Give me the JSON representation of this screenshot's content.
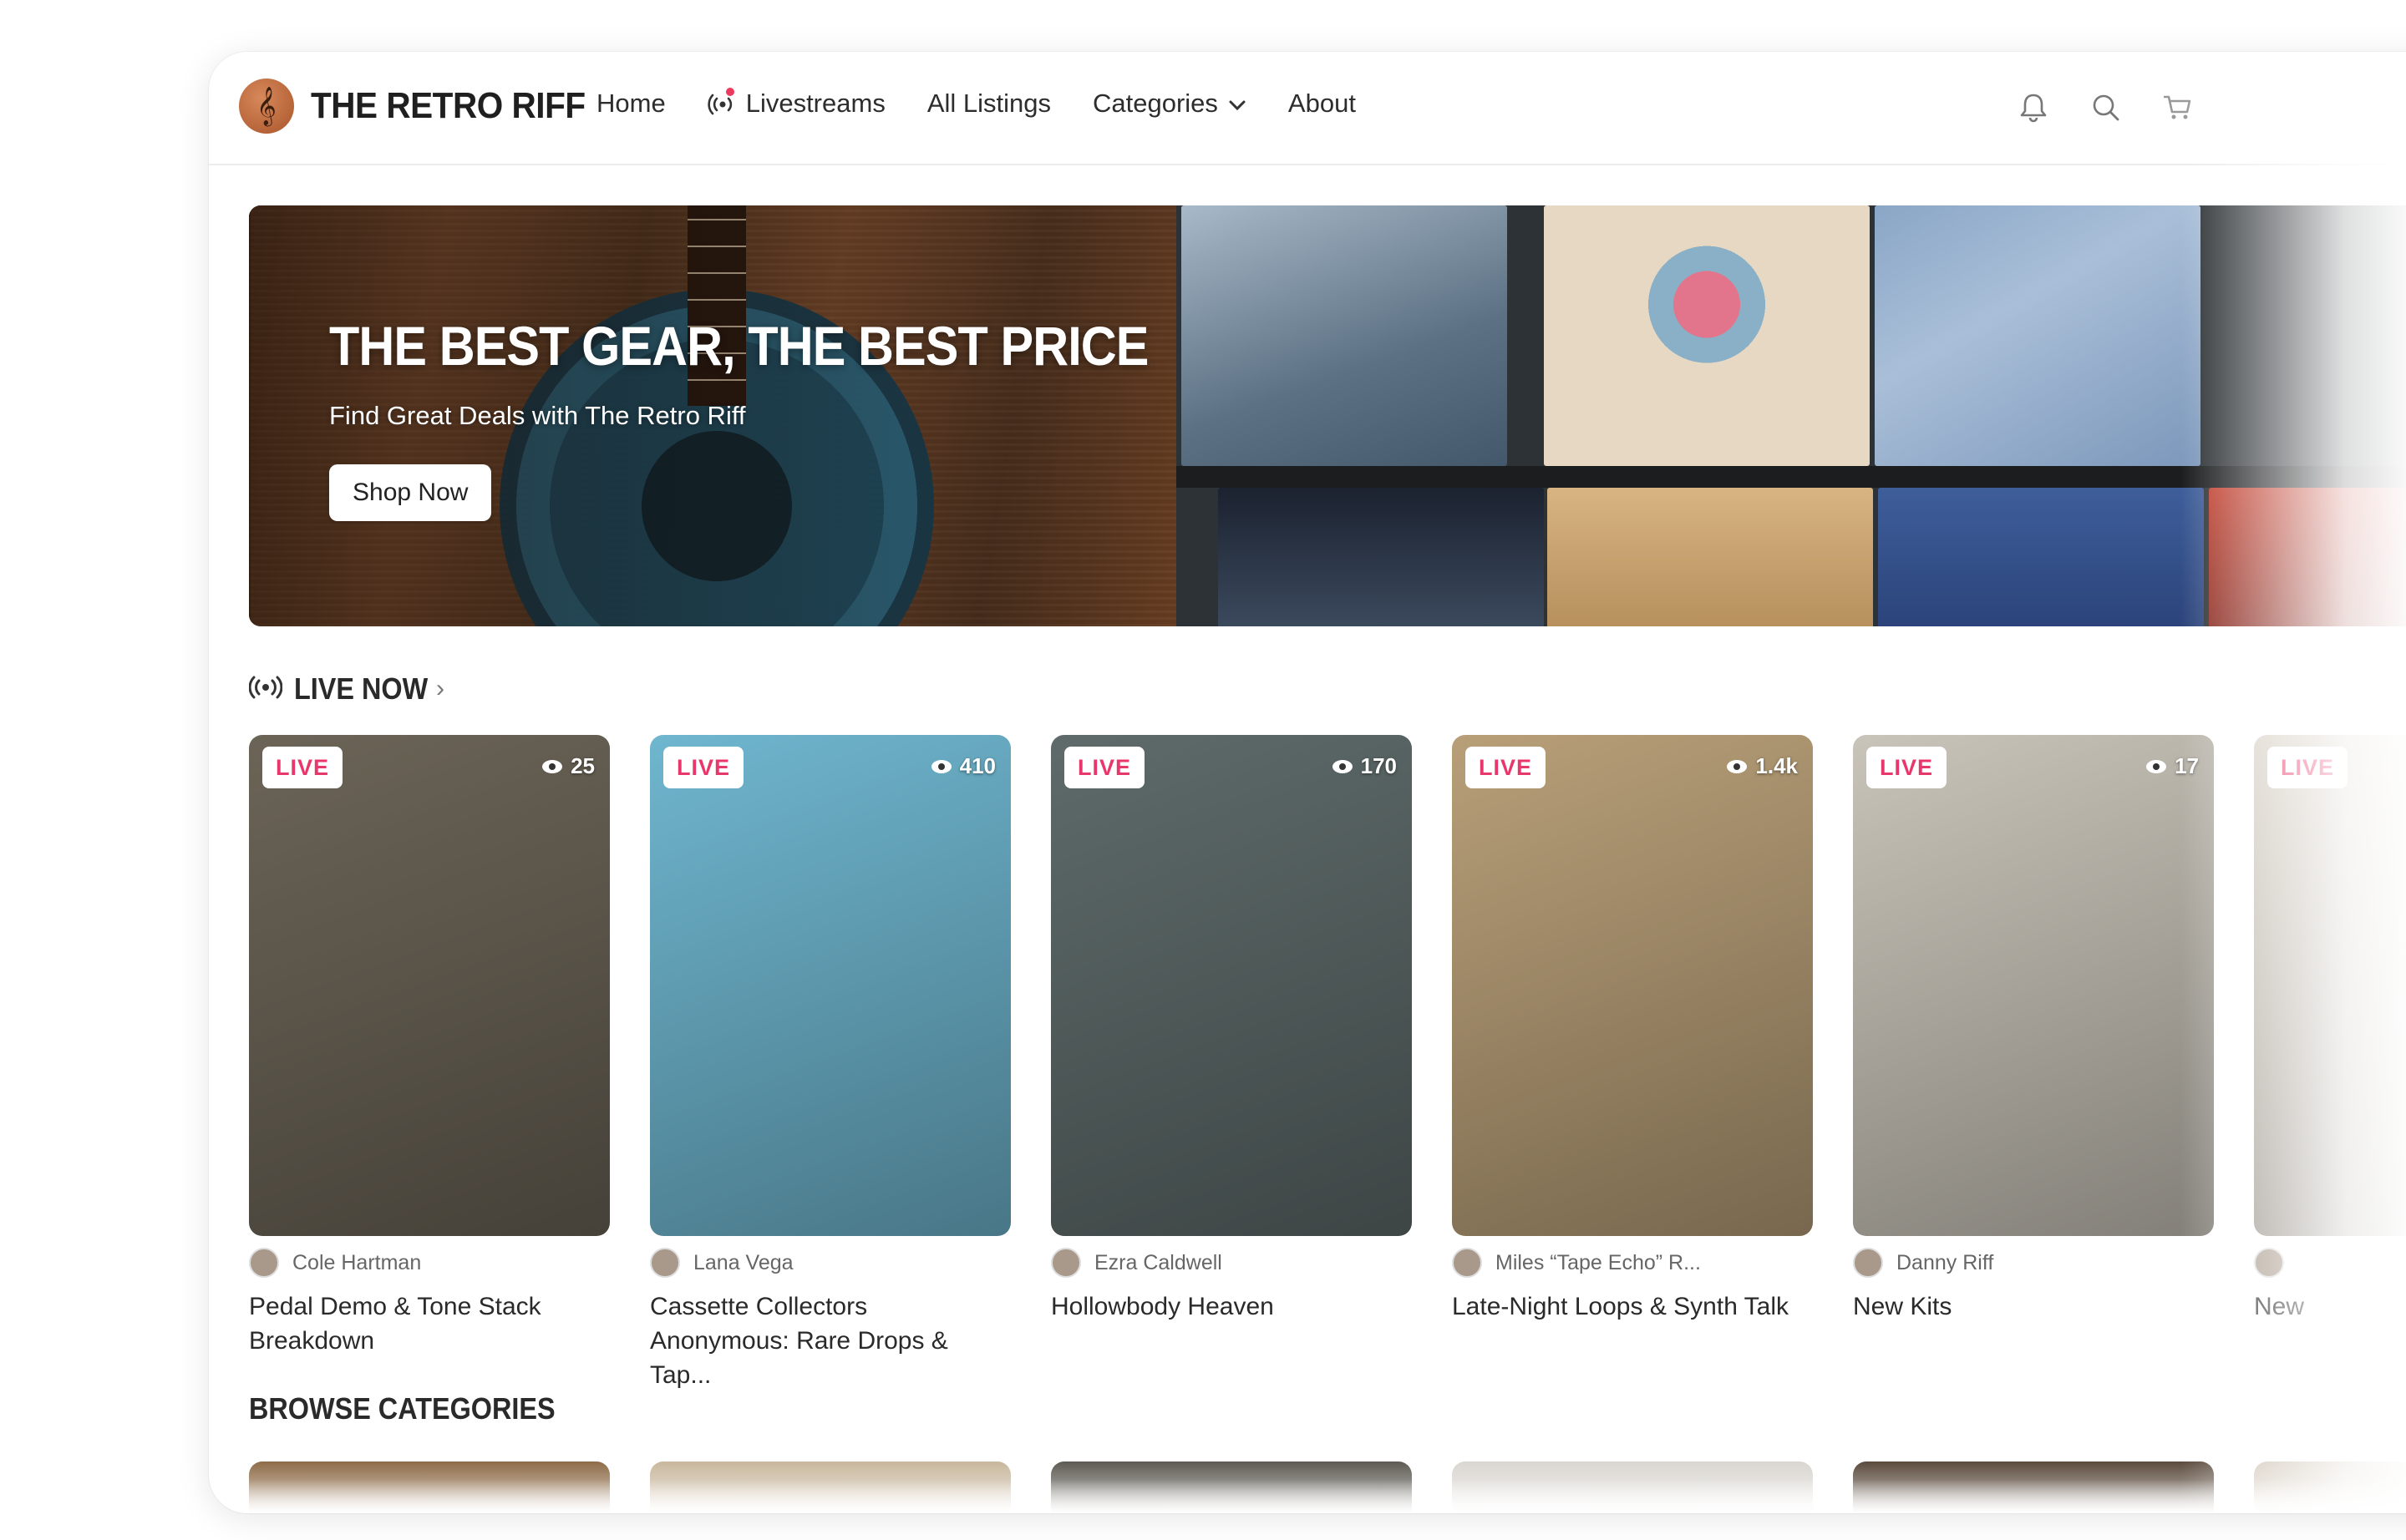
{
  "brand": {
    "name": "THE RETRO RIFF",
    "logo_glyph": "𝄞"
  },
  "nav": [
    {
      "label": "Home"
    },
    {
      "label": "Livestreams",
      "icon": "broadcast-icon"
    },
    {
      "label": "All Listings"
    },
    {
      "label": "Categories",
      "icon": "chevron-down-icon"
    },
    {
      "label": "About"
    }
  ],
  "header_icons": [
    "bell-icon",
    "search-icon",
    "cart-icon"
  ],
  "hero": {
    "title": "THE BEST GEAR, THE BEST PRICE",
    "subtitle": "Find Great Deals with The Retro Riff",
    "button": "Shop Now"
  },
  "live_now": {
    "title": "LIVE NOW",
    "chevron": "›",
    "badge": "LIVE",
    "streams": [
      {
        "viewers": "25",
        "host": "Cole Hartman",
        "title": "Pedal Demo & Tone Stack Breakdown",
        "thumb_color": "#6b6457"
      },
      {
        "viewers": "410",
        "host": "Lana Vega",
        "title": "Cassette Collectors Anonymous: Rare Drops & Tap...",
        "thumb_color": "#6fb6cf"
      },
      {
        "viewers": "170",
        "host": "Ezra Caldwell",
        "title": "Hollowbody Heaven",
        "thumb_color": "#5e6b6a"
      },
      {
        "viewers": "1.4k",
        "host": "Miles “Tape Echo” R...",
        "title": "Late-Night Loops & Synth Talk",
        "thumb_color": "#b89f78"
      },
      {
        "viewers": "17",
        "host": "Danny Riff",
        "title": "New Kits",
        "thumb_color": "#c9c4b9"
      },
      {
        "viewers": "",
        "host": "",
        "title": "New",
        "thumb_color": "#d8d0c4"
      }
    ]
  },
  "browse": {
    "title": "BROWSE CATEGORIES",
    "tiles": [
      "#8d6b48",
      "#c8b79d",
      "#5c5a52",
      "#d9d6d0",
      "#5a4a3c",
      "#cbbfae"
    ]
  }
}
